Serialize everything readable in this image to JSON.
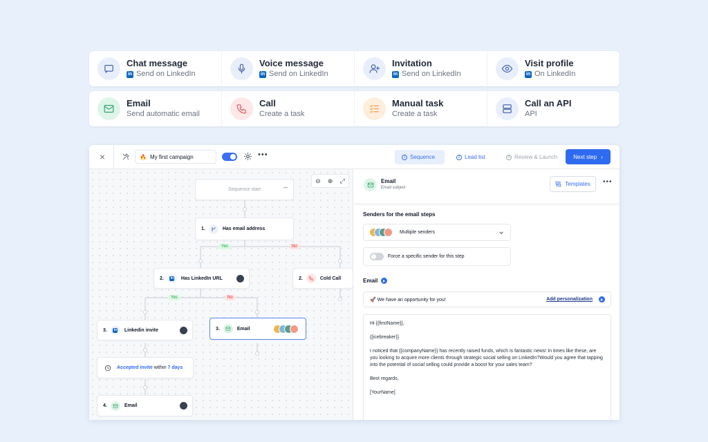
{
  "cards": [
    {
      "title": "Chat message",
      "sub": "Send on LinkedIn",
      "linkedin": true,
      "icon": "chat-bubble-icon",
      "bg": "#e8effb",
      "stroke": "#3b5ba9"
    },
    {
      "title": "Voice message",
      "sub": "Send on LinkedIn",
      "linkedin": true,
      "icon": "microphone-icon",
      "bg": "#e8effb",
      "stroke": "#3b5ba9"
    },
    {
      "title": "Invitation",
      "sub": "Send on LinkedIn",
      "linkedin": true,
      "icon": "user-plus-icon",
      "bg": "#e8effb",
      "stroke": "#3b5ba9"
    },
    {
      "title": "Visit profile",
      "sub": "On LinkedIn",
      "linkedin": true,
      "icon": "eye-icon",
      "bg": "#e8effb",
      "stroke": "#3b5ba9"
    },
    {
      "title": "Email",
      "sub": "Send automatic email",
      "linkedin": false,
      "icon": "mail-icon",
      "bg": "#dcf5e8",
      "stroke": "#2e9e6b"
    },
    {
      "title": "Call",
      "sub": "Create a task",
      "linkedin": false,
      "icon": "phone-icon",
      "bg": "#fde7e7",
      "stroke": "#e0565b"
    },
    {
      "title": "Manual task",
      "sub": "Create a task",
      "linkedin": false,
      "icon": "checklist-icon",
      "bg": "#fdeedd",
      "stroke": "#ee9a46"
    },
    {
      "title": "Call an API",
      "sub": "API",
      "linkedin": false,
      "icon": "server-icon",
      "bg": "#e8effb",
      "stroke": "#3b5ba9"
    }
  ],
  "linkedin_badge": "in",
  "topbar": {
    "close": "×",
    "campaign_emoji": "🔥",
    "campaign_name": "My first campaign",
    "more": "•••",
    "tabs": [
      {
        "num": "1",
        "label": "Sequence"
      },
      {
        "num": "2",
        "label": "Lead list"
      },
      {
        "num": "3",
        "label": "Review & Launch"
      }
    ],
    "next_label": "Next step",
    "next_arrow": "›"
  },
  "canvas": {
    "zoom_out": "⊖",
    "zoom_in": "⊕",
    "fullscreen": "⤢",
    "start_label": "Sequence start",
    "start_more": "•••",
    "nodes": [
      {
        "num": "1.",
        "label": "Has email address"
      },
      {
        "num": "2.",
        "label": "Has LinkedIn URL"
      },
      {
        "num": "2.",
        "label": "Cold Call"
      },
      {
        "num": "3.",
        "label": "Linkedin invite"
      },
      {
        "num": "3.",
        "label": "Email"
      },
      {
        "num": "4.",
        "label": "Email"
      }
    ],
    "wait_prefix": "Accepted invite",
    "wait_mid": " within ",
    "wait_days": "7 days",
    "yes": "Yes",
    "no": "No"
  },
  "panel": {
    "title": "Email",
    "subtitle": "Email subject",
    "templates_label": "Templates",
    "more": "•••",
    "senders_title": "Senders for the email steps",
    "senders_value": "Multiple senders",
    "force_label": "Force a specific sender for this step",
    "email_title": "Email",
    "subject_value": "🚀 We have an opportunity for you!",
    "add_personalization": "Add personalization",
    "body": [
      "Hi {{firstName}},",
      "{{icebreaker}}",
      "I noticed that {{companyName}} has recently raised funds, which is fantastic news! In times like these, are you looking to acquire more clients through strategic social selling on LinkedIn?Would you agree that tapping into the potential of social selling could provide a boost for your sales team?",
      "Best regards,",
      "[YourName]"
    ]
  },
  "colors": {
    "accent": "#2f6bf0",
    "yes": "#16a34a",
    "no": "#dc2626"
  }
}
